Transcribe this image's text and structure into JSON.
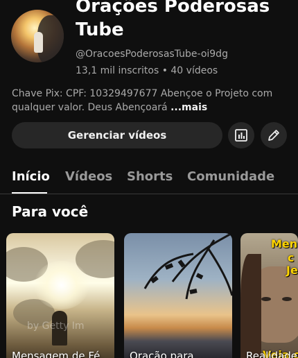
{
  "channel": {
    "title_line1": "Orações Poderosas",
    "title_line2": "Tube",
    "handle": "@OracoesPoderosasTube-oi9dg",
    "stats": "13,1 mil inscritos • 40 vídeos",
    "description": "Chave Pix: CPF: 10329497677 Abençoe o Projeto com qualquer valor. Deus Abençoará",
    "more_label": "...mais"
  },
  "actions": {
    "manage_label": "Gerenciar vídeos",
    "analytics_icon": "analytics-icon",
    "edit_icon": "pencil-icon"
  },
  "tabs": [
    {
      "label": "Início",
      "active": true
    },
    {
      "label": "Vídeos",
      "active": false
    },
    {
      "label": "Shorts",
      "active": false
    },
    {
      "label": "Comunidade",
      "active": false
    }
  ],
  "section": {
    "title": "Para você",
    "videos": [
      {
        "caption": "Mensagem de Fé.",
        "watermark": "by Getty Im"
      },
      {
        "caption": "Oração para"
      },
      {
        "caption": "Realidade",
        "overlay_top": "Mens",
        "overlay_mid": "c",
        "overlay_low": "Je",
        "overlay_bottom": "Veja o"
      }
    ]
  },
  "colors": {
    "background": "#0f0f0f",
    "button": "#272727",
    "secondary_text": "#aaaaaa",
    "overlay_yellow": "#ffd400"
  }
}
